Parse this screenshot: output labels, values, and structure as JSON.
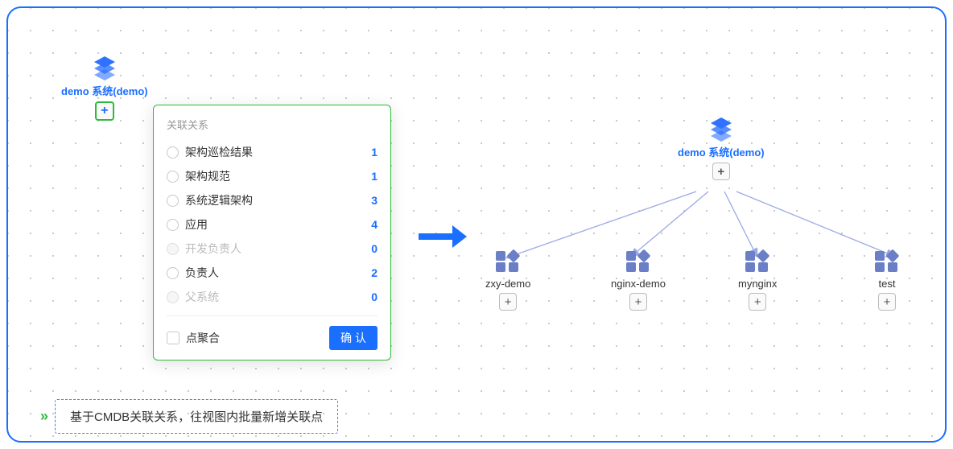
{
  "leftNode": {
    "label": "demo 系统(demo)"
  },
  "popover": {
    "title": "关联关系",
    "items": [
      {
        "label": "架构巡检结果",
        "count": "1",
        "disabled": false
      },
      {
        "label": "架构规范",
        "count": "1",
        "disabled": false
      },
      {
        "label": "系统逻辑架构",
        "count": "3",
        "disabled": false
      },
      {
        "label": "应用",
        "count": "4",
        "disabled": false
      },
      {
        "label": "开发负责人",
        "count": "0",
        "disabled": true
      },
      {
        "label": "负责人",
        "count": "2",
        "disabled": false
      },
      {
        "label": "父系统",
        "count": "0",
        "disabled": true
      }
    ],
    "aggregate_label": "点聚合",
    "confirm_label": "确 认"
  },
  "rightRoot": {
    "label": "demo 系统(demo)"
  },
  "children": [
    {
      "label": "zxy-demo"
    },
    {
      "label": "nginx-demo"
    },
    {
      "label": "mynginx"
    },
    {
      "label": "test"
    }
  ],
  "caption": "基于CMDB关联关系，往视图内批量新增关联点"
}
